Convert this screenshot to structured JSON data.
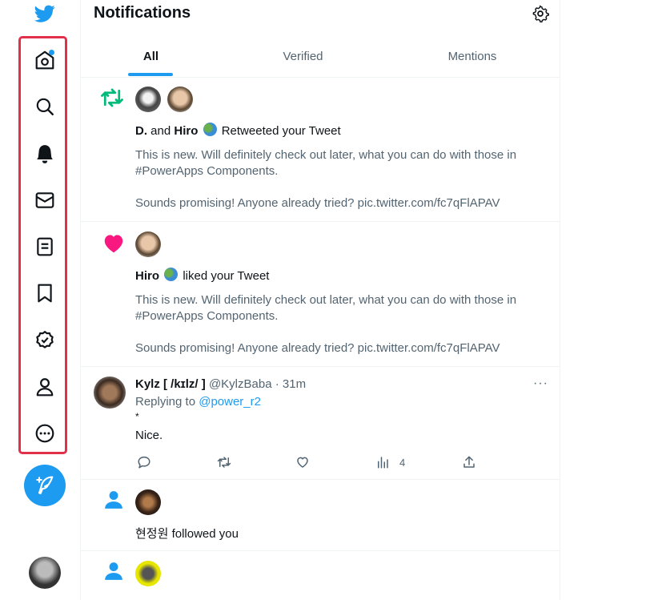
{
  "header": {
    "title": "Notifications"
  },
  "tabs": [
    {
      "label": "All"
    },
    {
      "label": "Verified"
    },
    {
      "label": "Mentions"
    }
  ],
  "notifications": [
    {
      "type": "retweet",
      "actor1": "D.",
      "joiner": "and",
      "actor2": "Hiro",
      "action": "Retweeted your Tweet",
      "text1": "This is new. Will definitely check out later, what you can do with those in",
      "text2": "#PowerApps Components.",
      "text3": "Sounds promising! Anyone already tried? pic.twitter.com/fc7qFlAPAV"
    },
    {
      "type": "like",
      "actor": "Hiro",
      "action": "liked your Tweet",
      "text1": "This is new. Will definitely check out later, what you can do with those in",
      "text2": "#PowerApps Components.",
      "text3": "Sounds promising! Anyone already tried? pic.twitter.com/fc7qFlAPAV"
    },
    {
      "type": "reply",
      "name": "Kylz [ /kɪlz/ ]",
      "handle": "@KylzBaba",
      "time": "· 31m",
      "replying_prefix": "Replying to",
      "replying_to": "@power_r2",
      "line1": "*",
      "line2": "Nice.",
      "views": "4"
    },
    {
      "type": "follow",
      "actor": "현정원",
      "action": "followed you"
    }
  ],
  "icons": {
    "nav": [
      "home-icon",
      "search-icon",
      "notifications-icon",
      "messages-icon",
      "lists-icon",
      "bookmarks-icon",
      "verified-icon",
      "profile-icon",
      "more-icon"
    ]
  },
  "colors": {
    "accent": "#1d9bf0",
    "highlight": "#e0304a",
    "retweet": "#00ba7c",
    "like": "#f91880"
  }
}
